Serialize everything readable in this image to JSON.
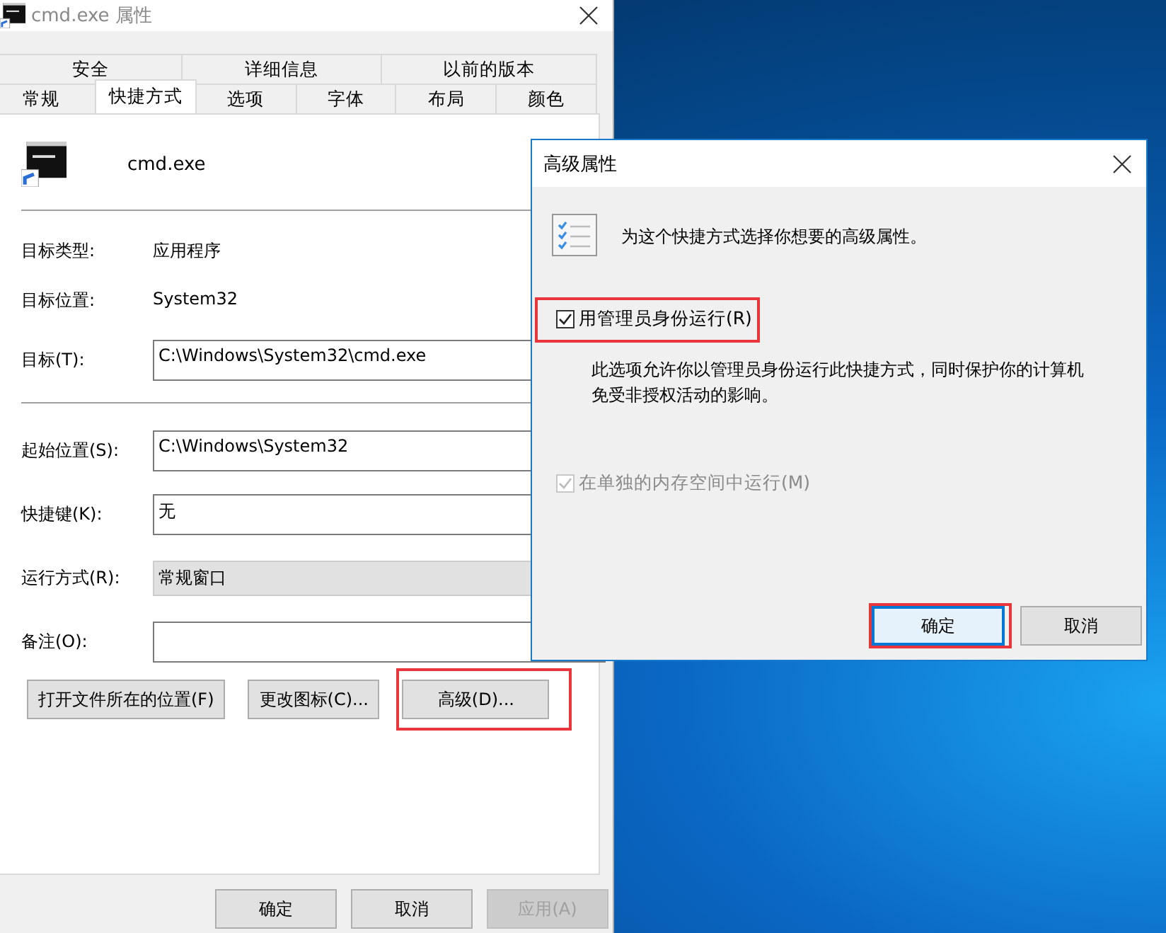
{
  "main_window": {
    "title": "cmd.exe 属性",
    "tab_rows": [
      [
        {
          "label": "安全",
          "selected": false
        },
        {
          "label": "详细信息",
          "selected": false
        },
        {
          "label": "以前的版本",
          "selected": false
        }
      ],
      [
        {
          "label": "常规",
          "selected": false
        },
        {
          "label": "快捷方式",
          "selected": true
        },
        {
          "label": "选项",
          "selected": false
        },
        {
          "label": "字体",
          "selected": false
        },
        {
          "label": "布局",
          "selected": false
        },
        {
          "label": "颜色",
          "selected": false
        }
      ]
    ],
    "file_name": "cmd.exe",
    "info": [
      {
        "label": "目标类型:",
        "value": "应用程序"
      },
      {
        "label": "目标位置:",
        "value": "System32"
      }
    ],
    "target": {
      "label": "目标(T):",
      "value": "C:\\Windows\\System32\\cmd.exe"
    },
    "fields": [
      {
        "label": "起始位置(S):",
        "value": "C:\\Windows\\System32",
        "kind": "text"
      },
      {
        "label": "快捷键(K):",
        "value": "无",
        "kind": "text"
      },
      {
        "label": "运行方式(R):",
        "value": "常规窗口",
        "kind": "dropdown"
      },
      {
        "label": "备注(O):",
        "kind": "text"
      }
    ],
    "buttons": [
      {
        "label": "打开文件所在的位置(F)",
        "highlighted": false
      },
      {
        "label": "更改图标(C)...",
        "highlighted": false
      },
      {
        "label": "高级(D)...",
        "highlighted": true
      }
    ],
    "footer_buttons": [
      {
        "label": "确定",
        "disabled": false
      },
      {
        "label": "取消",
        "disabled": false
      },
      {
        "label": "应用(A)",
        "disabled": true
      }
    ]
  },
  "dialog": {
    "title": "高级属性",
    "intro": "为这个快捷方式选择你想要的高级属性。",
    "options": [
      {
        "label": "用管理员身份运行(R)",
        "checked": true,
        "disabled": false,
        "highlighted": true,
        "description": "此选项允许你以管理员身份运行此快捷方式，同时保护你的计算机免受非授权活动的影响。"
      },
      {
        "label": "在单独的内存空间中运行(M)",
        "checked": true,
        "disabled": true,
        "highlighted": false
      }
    ],
    "buttons": [
      {
        "label": "确定",
        "default": true,
        "highlighted": true
      },
      {
        "label": "取消",
        "default": false,
        "highlighted": false
      }
    ]
  }
}
